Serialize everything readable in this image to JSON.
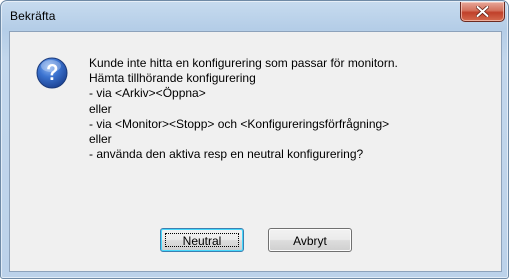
{
  "window": {
    "title": "Bekräfta"
  },
  "dialog": {
    "icon": "question-icon",
    "message_lines": [
      "Kunde inte hitta en konfigurering som passar för monitorn.",
      "Hämta tillhörande konfigurering",
      "- via <Arkiv><Öppna>",
      "eller",
      "- via <Monitor><Stopp> och <Konfigureringsförfrågning>",
      "eller",
      "- använda den aktiva resp en neutral konfigurering?"
    ]
  },
  "buttons": {
    "neutral_label": "Neutral",
    "cancel_label": "Avbryt"
  },
  "colors": {
    "frame": "#b9d1ea",
    "client_bg": "#f0f0f0",
    "close_button": "#c7503a",
    "question_icon": "#2c5fb8"
  }
}
